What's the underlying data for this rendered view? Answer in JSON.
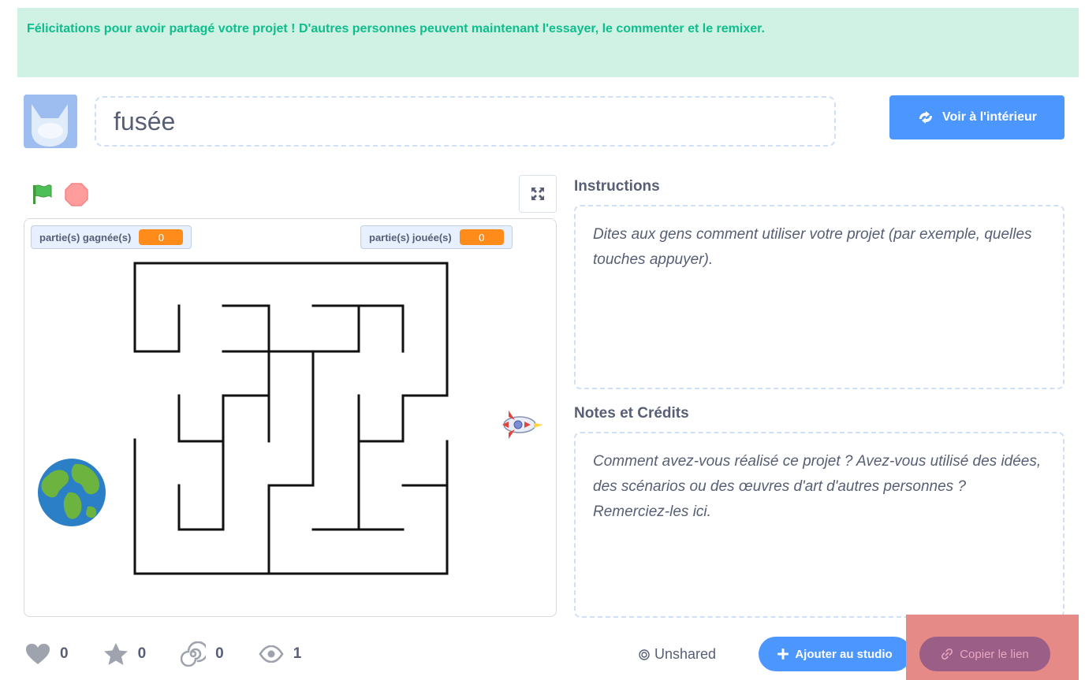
{
  "banner": {
    "message": "Félicitations pour avoir partagé votre projet ! D'autres personnes peuvent maintenant l'essayer, le commenter et le remixer."
  },
  "project": {
    "title": "fusée"
  },
  "header": {
    "see_inside_label": "Voir à l'intérieur",
    "see_inside_icon": "remix-arrows-icon"
  },
  "player": {
    "monitors": [
      {
        "label": "partie(s) gagnée(s)",
        "value": "0"
      },
      {
        "label": "partie(s) jouée(s)",
        "value": "0"
      }
    ]
  },
  "instructions": {
    "title": "Instructions",
    "placeholder": "Dites aux gens comment utiliser votre projet (par exemple, quelles touches appuyer)."
  },
  "notes": {
    "title": "Notes et Crédits",
    "placeholder": "Comment avez-vous réalisé ce projet ? Avez-vous utilisé des idées, des scénarios ou des œuvres d'art d'autres personnes ? Remerciez-les ici."
  },
  "stats": {
    "loves": "0",
    "favorites": "0",
    "remixes": "0",
    "views": "1"
  },
  "footer": {
    "unshared_label": "Unshared",
    "add_studio_label": "Ajouter au studio",
    "copy_link_label": "Copier le lien"
  },
  "colors": {
    "accent": "#4c97ff",
    "banner_bg": "#cff2e5",
    "banner_text": "#0fbd8c",
    "monitor_value": "#ff8c1a"
  }
}
